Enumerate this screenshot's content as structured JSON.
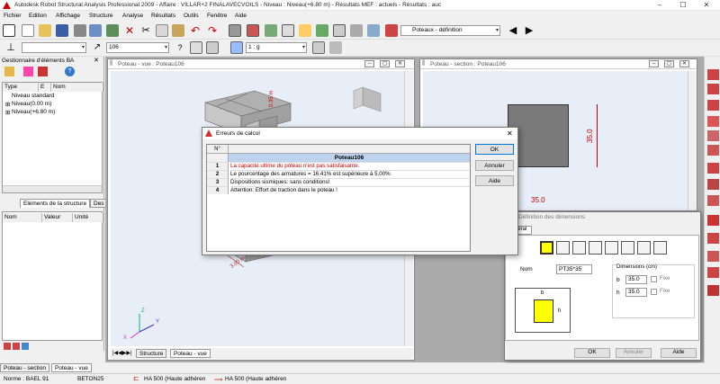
{
  "app": {
    "title": "Autodesk Robot Structural Analysis Professional 2009 - Affaire : VILLAR+2 FINALAVECVOILS - Niveau : Niveau(+6.80 m) - Résultats MEF : actuels - Résultats : auc",
    "win_min": "–",
    "win_max": "☐",
    "win_close": "✕"
  },
  "menu": [
    "Fichier",
    "Edition",
    "Affichage",
    "Structure",
    "Analyse",
    "Résultats",
    "Outils",
    "Fenêtre",
    "Aide"
  ],
  "toolbar1": {
    "selector_value": "Poteaux - définition",
    "arrow_left": "◀",
    "arrow_right": "▶"
  },
  "toolbar2": {
    "combo1": "",
    "combo2": "106",
    "combo3": "1 : g"
  },
  "manager": {
    "title": "Gestionnaire d'éléments BA",
    "close": "✕",
    "cols": [
      "Type",
      "E",
      "Nom"
    ],
    "items": [
      "Niveau standard",
      "Niveau(0.00 m)",
      "Niveau(+6.80 m)"
    ],
    "tab_label": "Eléments de la structure",
    "tab2": "Des",
    "prop_cols": [
      "Nom",
      "Valeur",
      "Unité"
    ]
  },
  "win_vue": {
    "title": "Poteau - vue : Poteau106",
    "dim_label": "0.35 m",
    "dim_label2": "3.00 m",
    "tabs": [
      "Structure",
      "Poteau - vue"
    ],
    "axes": {
      "x": "X",
      "y": "Y",
      "z": "Z"
    }
  },
  "win_section": {
    "title": "Poteau - section : Poteau106",
    "dim_v": "35.0",
    "dim_h": "35.0"
  },
  "error_dialog": {
    "title": "Erreurs de calcul",
    "col_n": "N°",
    "header": "Poteau106",
    "rows": [
      {
        "n": "1",
        "text": "La capacité ultime du poteau n'est pas satisfaisante.",
        "color": "#c00000"
      },
      {
        "n": "2",
        "text": "Le pourcentage des armatures = 16.41% est supérieure à 5.00%",
        "color": "#000000"
      },
      {
        "n": "3",
        "text": "Dispositions sismiques: sans conditions!",
        "color": "#000000"
      },
      {
        "n": "4",
        "text": "Attention: Effort de traction dans le poteau !",
        "color": "#000000"
      }
    ],
    "ok": "OK",
    "cancel": "Annuler",
    "help": "Aide",
    "close": "✕"
  },
  "dims_dialog": {
    "title": "Définition des dimensions",
    "tab": "Général",
    "name_label": "Nom",
    "name_value": "PT35*35",
    "dims_group": "Dimensions (cm)",
    "b_label": "b",
    "b_value": "35.0",
    "h_label": "h",
    "h_value": "35.0",
    "fixe": "Fixe",
    "ok": "OK",
    "cancel": "Annuler",
    "help": "Aide",
    "sketch_b": "b",
    "sketch_h": "h"
  },
  "bottom_tabs": [
    "Poteau - section",
    "Poteau - vue"
  ],
  "status": {
    "norme": "Norme : BAEL 91",
    "beton": "BETON25",
    "acier1": "HA 500 (Haute adhéren",
    "acier2": "HA 500 (Haute adhéren"
  },
  "colors": {
    "accent": "#ffff00",
    "error_red": "#c00000",
    "header_blue": "#bcd2ee",
    "view_bg": "#e8eef8"
  }
}
